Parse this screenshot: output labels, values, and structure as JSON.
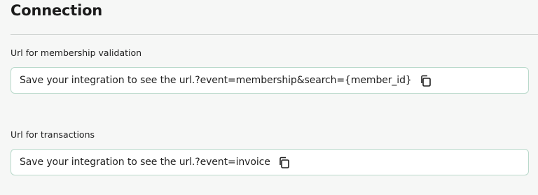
{
  "section": {
    "title": "Connection"
  },
  "fields": [
    {
      "label": "Url for membership validation",
      "value": "Save your integration to see the url.?event=membership&search={member_id}",
      "copy_icon": "copy-icon"
    },
    {
      "label": "Url for transactions",
      "value": "Save your integration to see the url.?event=invoice",
      "copy_icon": "copy-icon"
    }
  ],
  "colors": {
    "background": "#f6f7f6",
    "box_border": "#b9d9cb",
    "divider": "#cfd3d1"
  }
}
